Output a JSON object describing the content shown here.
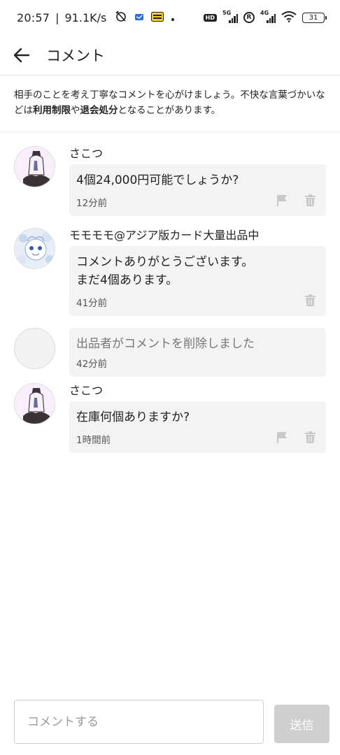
{
  "status_bar": {
    "time": "20:57",
    "speed": "91.1K/s",
    "hd": "HD",
    "net1": "5G",
    "net2": "4G",
    "roaming": "R",
    "battery": "31"
  },
  "header": {
    "title": "コメント",
    "back_icon": "arrow-left-icon"
  },
  "notice": {
    "part1": "相手のことを考え丁寧なコメントを心がけましょう。不快な言葉づかいなどは",
    "bold1": "利用制限",
    "part2": "や",
    "bold2": "退会処分",
    "part3": "となることがあります。"
  },
  "comments": [
    {
      "name": "さこつ",
      "text": "4個24,000円可能でしょうか?",
      "time": "12分前"
    },
    {
      "name": "モモモモ@アジア版カード大量出品中",
      "text": "コメントありがとうございます。\nまだ4個あります。",
      "time": "41分前"
    },
    {
      "name": "",
      "text": "出品者がコメントを削除しました",
      "time": "42分前"
    },
    {
      "name": "さこつ",
      "text": "在庫何個ありますか?",
      "time": "1時間前"
    }
  ],
  "compose": {
    "placeholder": "コメントする",
    "send_label": "送信"
  },
  "colors": {
    "bubble": "#f3f3f3",
    "send_disabled": "#cfcfcf",
    "icon_gray": "#c8c8c8"
  }
}
